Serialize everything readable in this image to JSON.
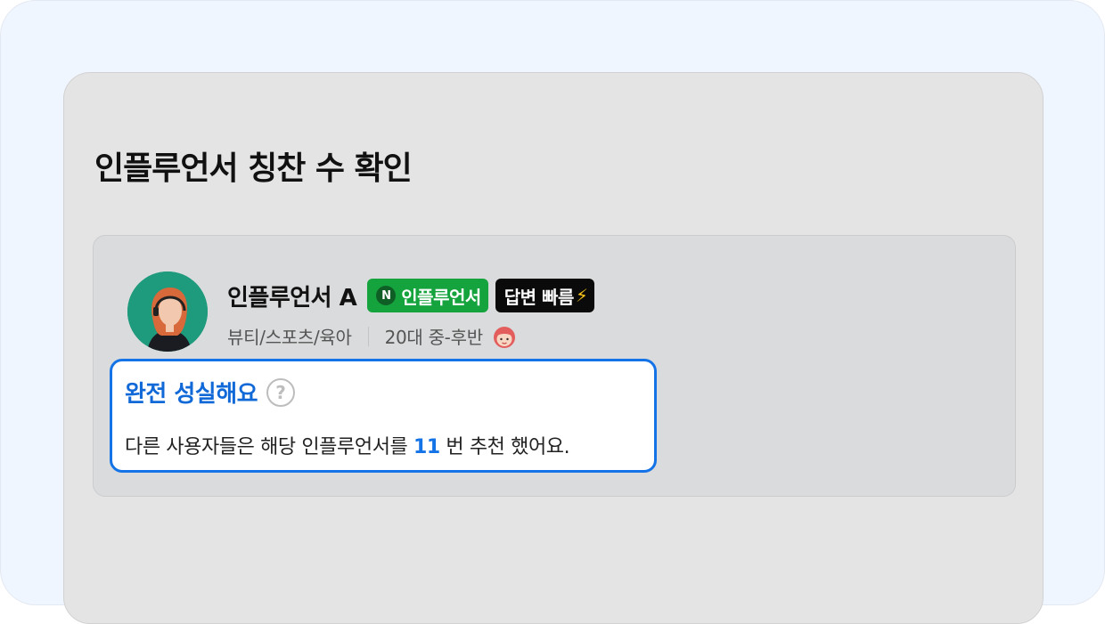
{
  "page": {
    "title": "인플루언서 칭찬 수 확인"
  },
  "influencer": {
    "name": "인플루언서 A",
    "badges": {
      "influencer_mark": "N",
      "influencer": "인플루언서",
      "fast_reply": "답변 빠름",
      "fast_reply_icon": "⚡"
    },
    "category": "뷰티/스포츠/육아",
    "age": "20대 중-후반",
    "avatar_icon": "user-avatar-icon",
    "gender_icon": "girl-face-icon"
  },
  "praise": {
    "title": "완전 성실해요",
    "help_icon": "?",
    "text_before": "다른 사용자들은 해당 인플루언서를 ",
    "count": "11",
    "text_after": " 번 추천 했어요."
  },
  "colors": {
    "background": "#f0f6ff",
    "panel": "#e4e4e4",
    "card": "#dadbdd",
    "accent_blue": "#1473e6",
    "badge_green": "#15a33d",
    "badge_black": "#0a0a0a"
  }
}
